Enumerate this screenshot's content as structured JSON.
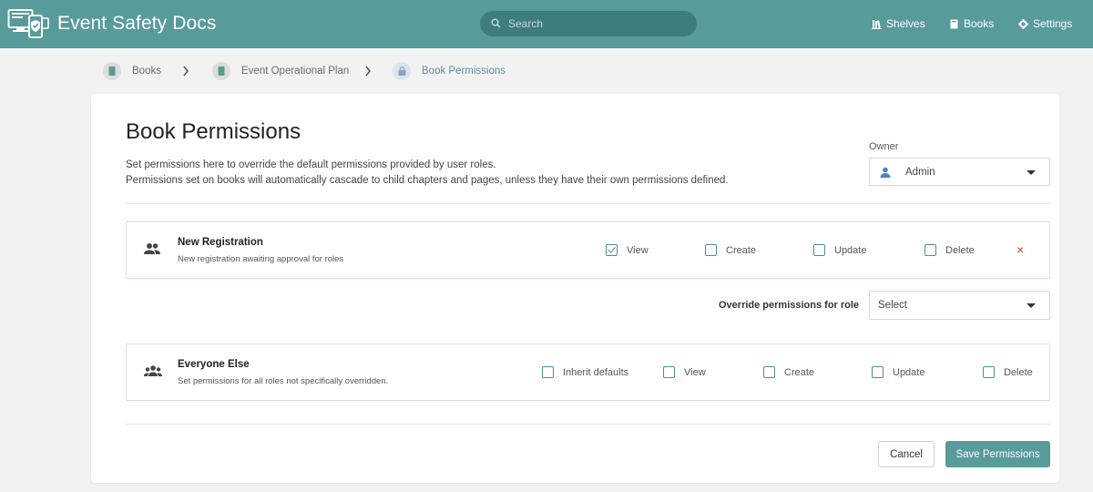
{
  "header": {
    "app_title": "Event Safety Docs",
    "search_placeholder": "Search",
    "nav": [
      {
        "label": "Shelves",
        "icon": "shelves-icon"
      },
      {
        "label": "Books",
        "icon": "book-icon"
      },
      {
        "label": "Settings",
        "icon": "gear-icon"
      }
    ],
    "bg_color": "#579b9a",
    "search_bg": "#3f7d7c"
  },
  "breadcrumb": [
    {
      "label": "Books",
      "icon": "book-icon"
    },
    {
      "label": "Event Operational Plan",
      "icon": "book-icon"
    },
    {
      "label": "Book Permissions",
      "icon": "lock-icon"
    }
  ],
  "page": {
    "title": "Book Permissions",
    "desc_line1": "Set permissions here to override the default permissions provided by user roles.",
    "desc_line2": "Permissions set on books will automatically cascade to child chapters and pages, unless they have their own permissions defined.",
    "owner_label": "Owner",
    "owner_value": "Admin"
  },
  "role_row": {
    "name": "New Registration",
    "subtitle": "New registration awaiting approval for roles",
    "perms": [
      {
        "label": "View",
        "checked": true
      },
      {
        "label": "Create",
        "checked": false
      },
      {
        "label": "Update",
        "checked": false
      },
      {
        "label": "Delete",
        "checked": false
      }
    ],
    "remove_symbol": "×"
  },
  "override": {
    "label": "Override permissions for role",
    "select_value": "Select"
  },
  "everyone_row": {
    "name": "Everyone Else",
    "subtitle": "Set permissions for all roles not specifically overridden.",
    "perms": [
      {
        "label": "Inherit defaults",
        "checked": false
      },
      {
        "label": "View",
        "checked": false
      },
      {
        "label": "Create",
        "checked": false
      },
      {
        "label": "Update",
        "checked": false
      },
      {
        "label": "Delete",
        "checked": false
      }
    ]
  },
  "actions": {
    "cancel": "Cancel",
    "save": "Save Permissions"
  }
}
